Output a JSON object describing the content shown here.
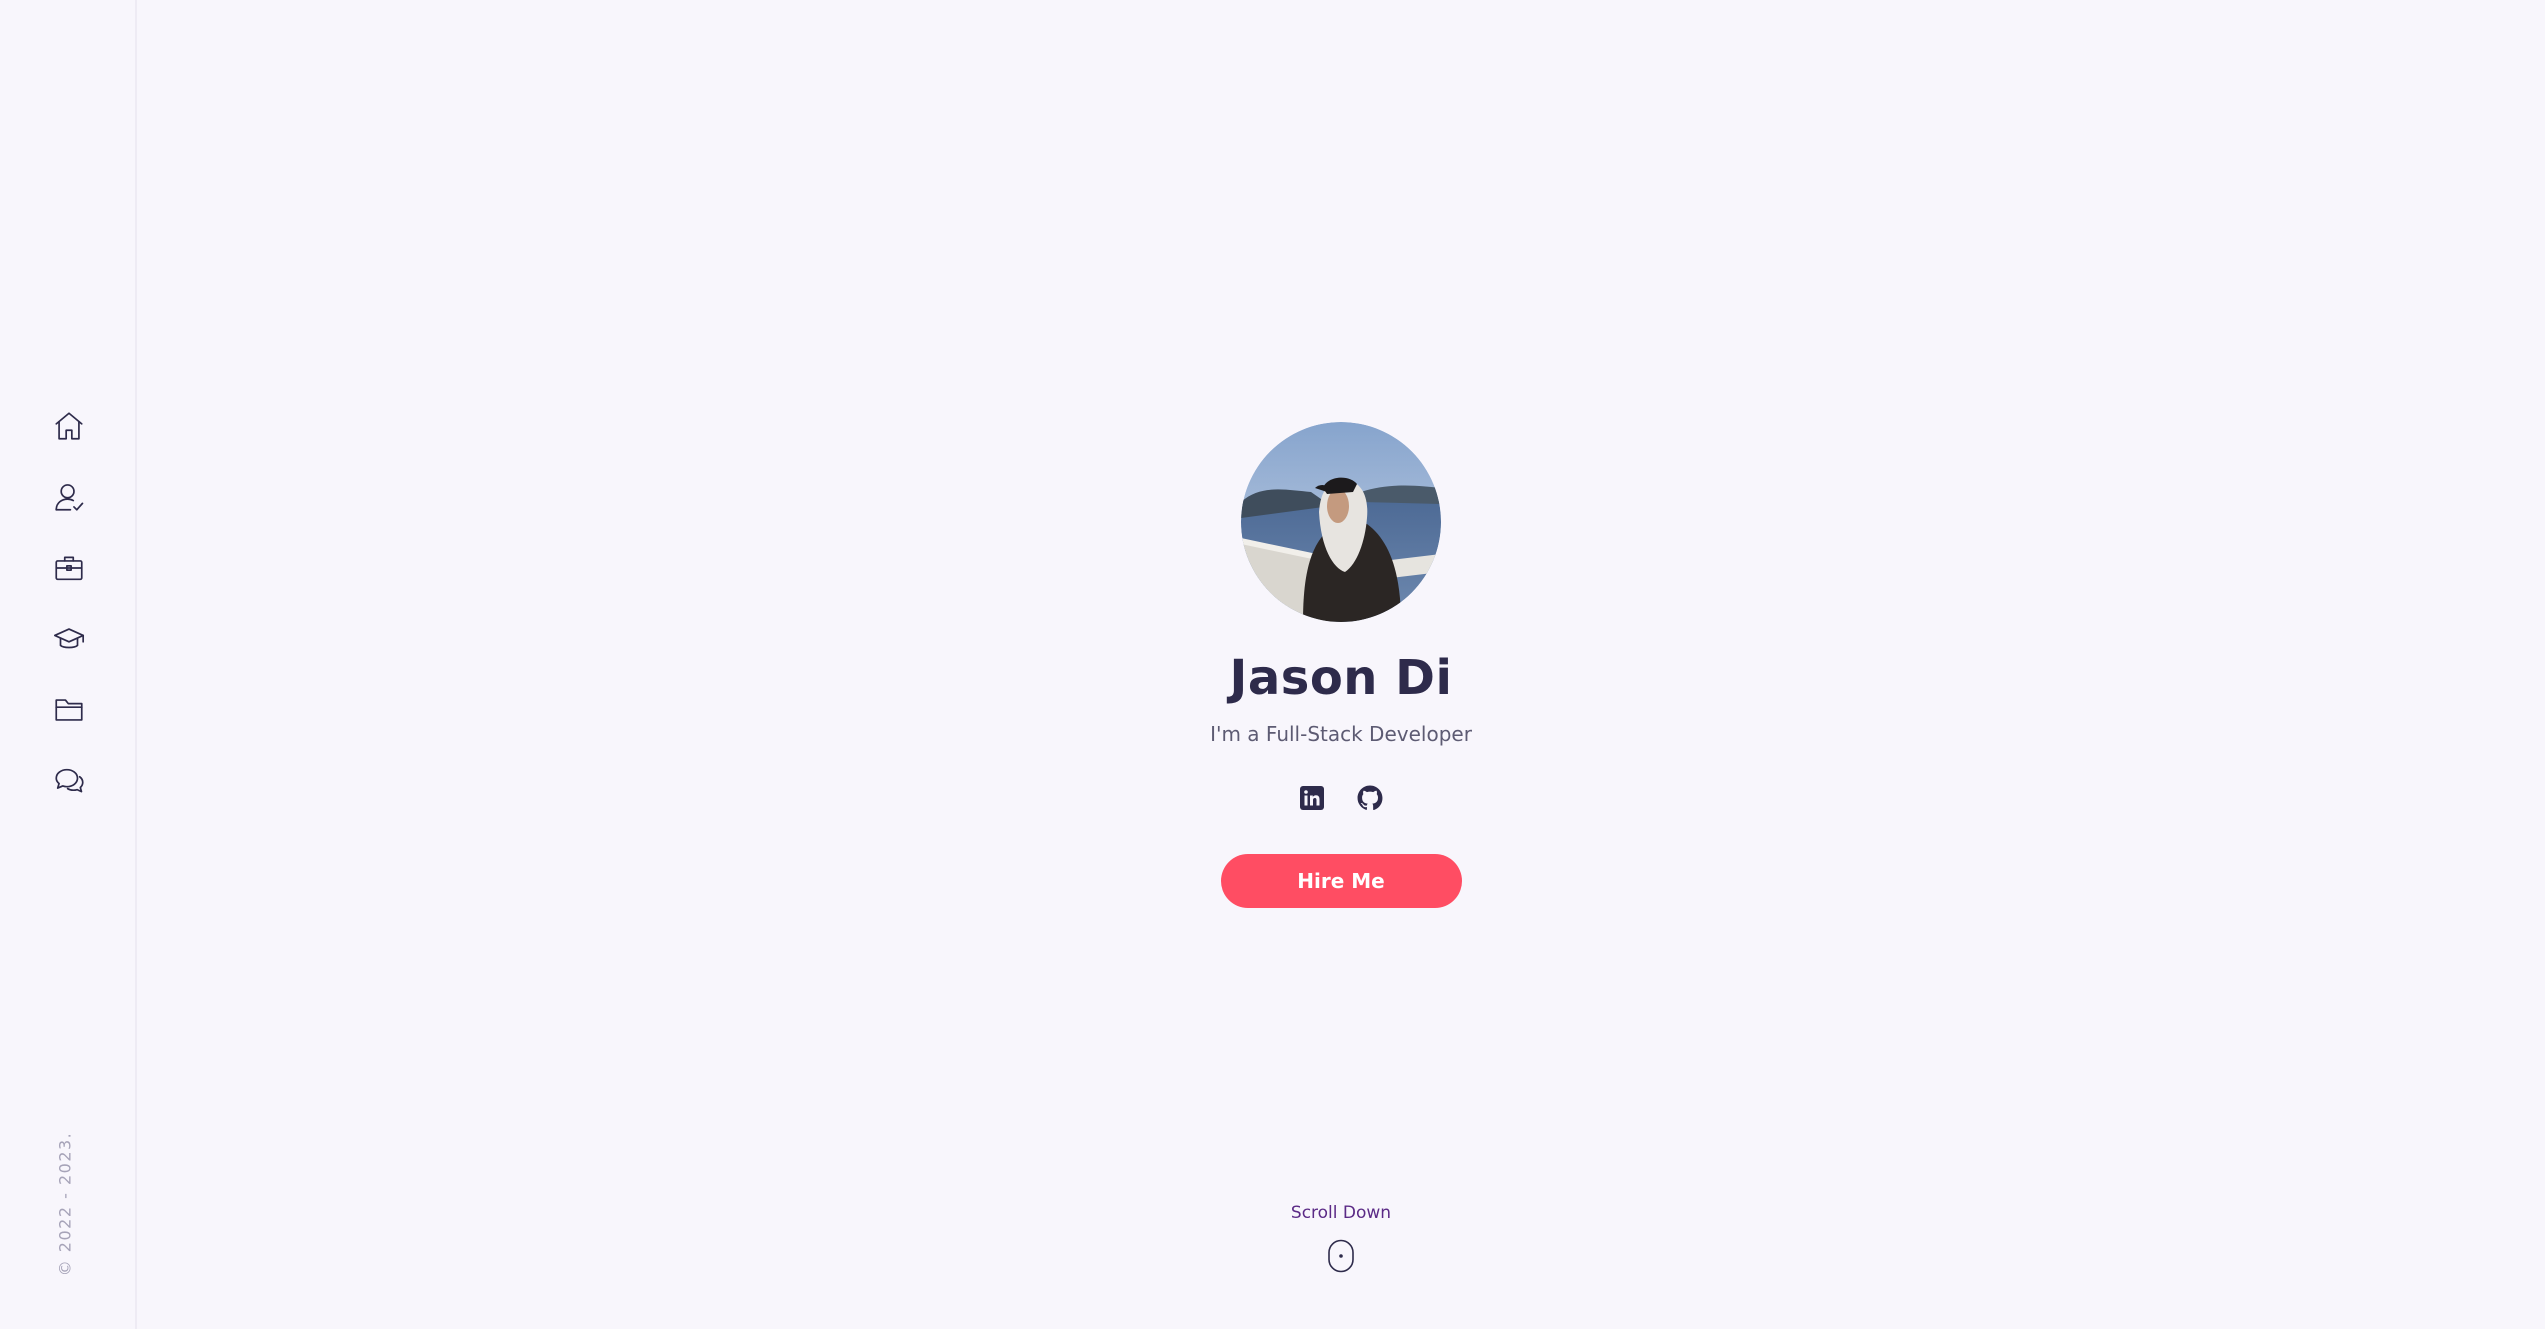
{
  "sidebar": {
    "nav": [
      {
        "icon": "home-icon"
      },
      {
        "icon": "user-check-icon"
      },
      {
        "icon": "briefcase-icon"
      },
      {
        "icon": "graduation-cap-icon"
      },
      {
        "icon": "folder-icon"
      },
      {
        "icon": "chat-icon"
      }
    ],
    "copyright": "© 2022 - 2023."
  },
  "hero": {
    "name": "Jason Di",
    "tagline": "I'm a Full-Stack Developer",
    "socials": [
      {
        "icon": "linkedin-icon"
      },
      {
        "icon": "github-icon"
      }
    ],
    "hire_label": "Hire Me"
  },
  "scroll": {
    "label": "Scroll Down",
    "icon": "mouse-icon"
  },
  "colors": {
    "background": "#f8f6fc",
    "accent": "#ff4d63",
    "text_dark": "#2e2b4b",
    "scroll_label": "#5b2a86"
  }
}
